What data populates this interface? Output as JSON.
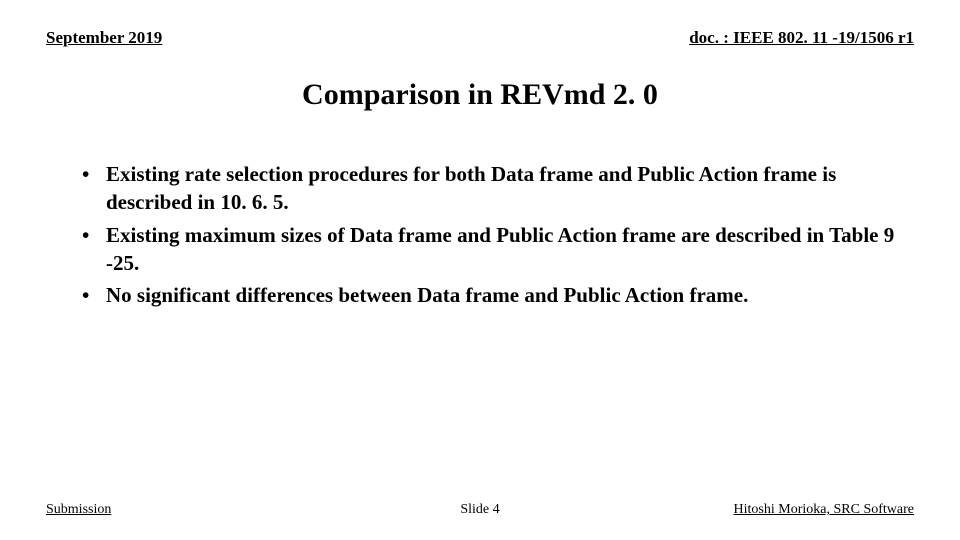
{
  "header": {
    "date": "September 2019",
    "docref": "doc. : IEEE 802. 11 -19/1506 r1"
  },
  "title": "Comparison in REVmd 2. 0",
  "bullets": [
    "Existing rate selection procedures for both Data frame and Public Action frame is described in 10. 6. 5.",
    "Existing maximum sizes of Data frame and Public Action frame are described in Table 9 -25.",
    "No significant differences between Data frame and Public Action frame."
  ],
  "footer": {
    "left": "Submission",
    "center": "Slide 4",
    "right": "Hitoshi Morioka, SRC Software"
  }
}
